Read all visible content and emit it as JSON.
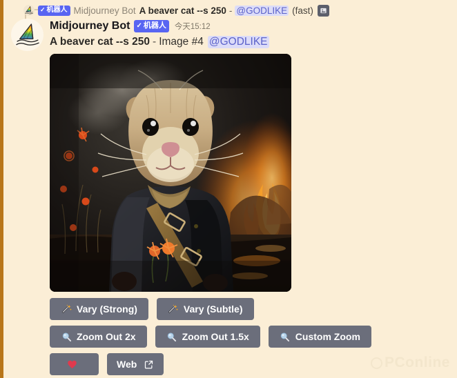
{
  "theme": {
    "background": "#fbeed6",
    "accent_stripe": "#b8761a",
    "bot_badge": "#5865f2",
    "button_bg": "#6b6e7b",
    "mention_bg": "#dcdcf8",
    "mention_text": "#5b62ca"
  },
  "reply": {
    "avatar_icon": "sailboat-icon",
    "badge_check": "✓",
    "badge_label": "机器人",
    "author": "Midjourney Bot",
    "prompt": "A beaver cat --s 250",
    "separator": "-",
    "mention": "@GODLIKE",
    "speed": "(fast)",
    "attachment_icon": "image-attachment-icon"
  },
  "message": {
    "avatar_icon": "sailboat-icon",
    "username": "Midjourney Bot",
    "badge_check": "✓",
    "badge_label": "机器人",
    "timestamp": "今天15:12",
    "prompt": "A beaver cat --s 250",
    "separator": "-",
    "image_label": "Image #4",
    "mention": "@GODLIKE"
  },
  "artwork": {
    "alt": "Beaver cat wearing a dark jacket with leather strap standing in water with fire and orange flowers"
  },
  "buttons": {
    "row1": [
      {
        "label": "Vary (Strong)",
        "icon": "magic-wand-icon",
        "name": "vary-strong-button"
      },
      {
        "label": "Vary (Subtle)",
        "icon": "magic-wand-icon",
        "name": "vary-subtle-button"
      }
    ],
    "row2": [
      {
        "label": "Zoom Out 2x",
        "icon": "magnifier-icon",
        "name": "zoom-out-2x-button"
      },
      {
        "label": "Zoom Out 1.5x",
        "icon": "magnifier-icon",
        "name": "zoom-out-1-5x-button"
      },
      {
        "label": "Custom Zoom",
        "icon": "magnifier-icon",
        "name": "custom-zoom-button"
      }
    ],
    "row3": [
      {
        "label": "",
        "icon": "heart-icon",
        "name": "favorite-button"
      },
      {
        "label": "Web",
        "icon": "external-link-icon",
        "name": "web-button"
      }
    ]
  },
  "watermark": {
    "text": "PConline"
  }
}
